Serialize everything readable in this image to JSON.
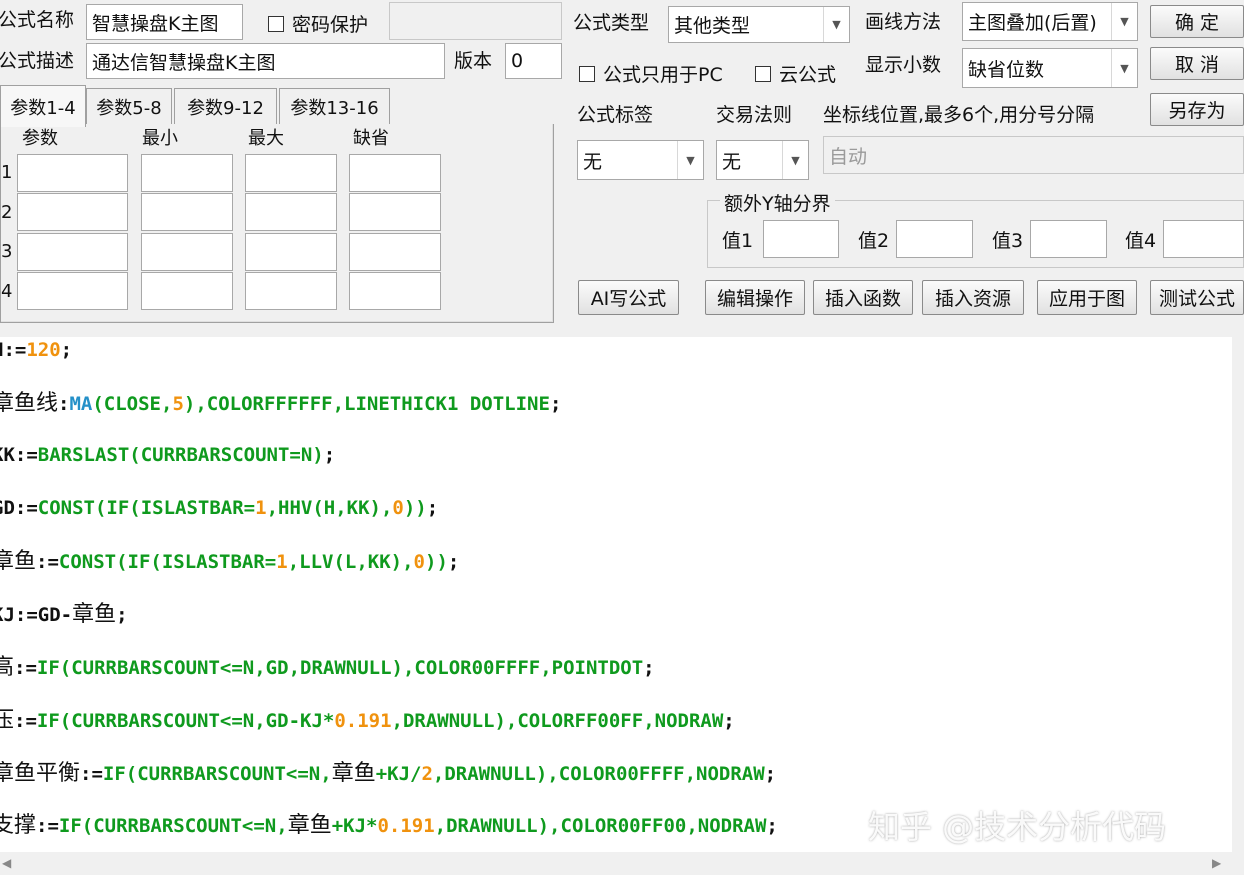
{
  "form": {
    "name_label": "公式名称",
    "name_value": "智慧操盘K主图",
    "password_label": "密码保护",
    "password_value": "",
    "desc_label": "公式描述",
    "desc_value": "通达信智慧操盘K主图",
    "version_label": "版本",
    "version_value": "0",
    "type_label": "公式类型",
    "type_value": "其他类型",
    "draw_label": "画线方法",
    "draw_value": "主图叠加(后置)",
    "pc_only_label": "公式只用于PC",
    "cloud_label": "云公式",
    "decimal_label": "显示小数",
    "decimal_value": "缺省位数",
    "tag_label": "公式标签",
    "tag_value": "无",
    "rule_label": "交易法则",
    "rule_value": "无",
    "axis_label": "坐标线位置,最多6个,用分号分隔",
    "axis_placeholder": "自动",
    "yaxis_group": "额外Y轴分界",
    "val1": "值1",
    "val2": "值2",
    "val3": "值3",
    "val4": "值4"
  },
  "buttons": {
    "ok": "确 定",
    "cancel": "取 消",
    "save_as": "另存为",
    "ai": "AI写公式",
    "edit": "编辑操作",
    "insert_func": "插入函数",
    "insert_res": "插入资源",
    "apply": "应用于图",
    "test": "测试公式"
  },
  "tabs": [
    "参数1-4",
    "参数5-8",
    "参数9-12",
    "参数13-16"
  ],
  "params": {
    "headers": [
      "参数",
      "最小",
      "最大",
      "缺省"
    ],
    "rows": [
      "1",
      "2",
      "3",
      "4"
    ]
  },
  "code_lines": [
    [
      [
        "c-b",
        "N:="
      ],
      [
        "c-o",
        "120"
      ],
      [
        "c-b",
        ";"
      ]
    ],
    [
      [
        "c-b cjk",
        "章鱼线"
      ],
      [
        "c-b",
        ":"
      ],
      [
        "c-c",
        "MA"
      ],
      [
        "c-g",
        "(CLOSE,"
      ],
      [
        "c-o",
        "5"
      ],
      [
        "c-g",
        "),COLORFFFFFF,LINETHICK1 DOTLINE"
      ],
      [
        "c-b",
        ";"
      ]
    ],
    [
      [
        "c-b",
        "KK:="
      ],
      [
        "c-g",
        "BARSLAST(CURRBARSCOUNT=N)"
      ],
      [
        "c-b",
        ";"
      ]
    ],
    [
      [
        "c-b",
        "GD:="
      ],
      [
        "c-g",
        "CONST(IF(ISLASTBAR="
      ],
      [
        "c-o",
        "1"
      ],
      [
        "c-g",
        ",HHV(H,KK),"
      ],
      [
        "c-o",
        "0"
      ],
      [
        "c-g",
        "))"
      ],
      [
        "c-b",
        ";"
      ]
    ],
    [
      [
        "c-b cjk",
        "章鱼"
      ],
      [
        "c-b",
        ":="
      ],
      [
        "c-g",
        "CONST(IF(ISLASTBAR="
      ],
      [
        "c-o",
        "1"
      ],
      [
        "c-g",
        ",LLV(L,KK),"
      ],
      [
        "c-o",
        "0"
      ],
      [
        "c-g",
        "))"
      ],
      [
        "c-b",
        ";"
      ]
    ],
    [
      [
        "c-b",
        "KJ:=GD-"
      ],
      [
        "c-b cjk",
        "章鱼"
      ],
      [
        "c-b",
        ";"
      ]
    ],
    [
      [
        "c-b cjk",
        "高"
      ],
      [
        "c-b",
        ":="
      ],
      [
        "c-g",
        "IF(CURRBARSCOUNT<=N,GD,DRAWNULL),COLOR00FFFF,POINTDOT"
      ],
      [
        "c-b",
        ";"
      ]
    ],
    [
      [
        "c-b cjk",
        "压"
      ],
      [
        "c-b",
        ":="
      ],
      [
        "c-g",
        "IF(CURRBARSCOUNT<=N,GD-KJ*"
      ],
      [
        "c-o",
        "0.191"
      ],
      [
        "c-g",
        ",DRAWNULL),COLORFF00FF,NODRAW"
      ],
      [
        "c-b",
        ";"
      ]
    ],
    [
      [
        "c-b cjk",
        "章鱼平衡"
      ],
      [
        "c-b",
        ":="
      ],
      [
        "c-g",
        "IF(CURRBARSCOUNT<=N,"
      ],
      [
        "c-b cjk",
        "章鱼"
      ],
      [
        "c-g",
        "+KJ/"
      ],
      [
        "c-o",
        "2"
      ],
      [
        "c-g",
        ",DRAWNULL),COLOR00FFFF,NODRAW"
      ],
      [
        "c-b",
        ";"
      ]
    ],
    [
      [
        "c-b cjk",
        "支撑"
      ],
      [
        "c-b",
        ":="
      ],
      [
        "c-g",
        "IF(CURRBARSCOUNT<=N,"
      ],
      [
        "c-b cjk",
        "章鱼"
      ],
      [
        "c-g",
        "+KJ*"
      ],
      [
        "c-o",
        "0.191"
      ],
      [
        "c-g",
        ",DRAWNULL),COLOR00FF00,NODRAW"
      ],
      [
        "c-b",
        ";"
      ]
    ]
  ],
  "watermark": "知乎 @技术分析代码"
}
